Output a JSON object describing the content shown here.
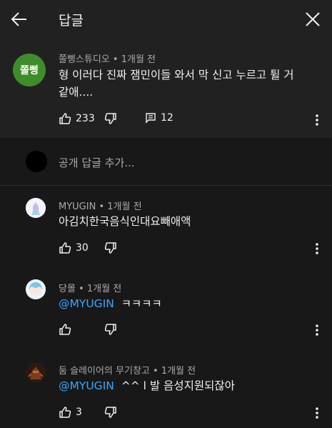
{
  "header": {
    "title": "답글",
    "back_icon": "arrow-left-icon",
    "close_icon": "close-icon"
  },
  "original_comment": {
    "avatar_text": "쫄삥",
    "author": "쫄삥스튜디오",
    "time": "1개월 전",
    "text_line1": "형 이러다 진짜 잼민이들 와서 막 신고 누르고 튈 거",
    "text_line2": "같애....",
    "likes": "233",
    "replies": "12"
  },
  "add_comment": {
    "placeholder": "공개 답글 추가..."
  },
  "replies": [
    {
      "author": "MYUGIN",
      "time": "1개월 전",
      "mention": "",
      "text": "아김치한국음식인대요빼애액",
      "likes": "30"
    },
    {
      "author": "당몰",
      "time": "1개월 전",
      "mention": "@MYUGIN",
      "text": "ㅋㅋㅋㅋ",
      "likes": ""
    },
    {
      "author": "둠 슬레이어의 무기창고",
      "time": "1개월 전",
      "mention": "@MYUGIN",
      "text": "^^ l 발 음성지원되잖아",
      "likes": "3"
    }
  ],
  "colors": {
    "background": "#181818",
    "header": "#212121",
    "mention": "#3ea6ff",
    "avatar_green": "#3f8d2a"
  },
  "separator": "•"
}
